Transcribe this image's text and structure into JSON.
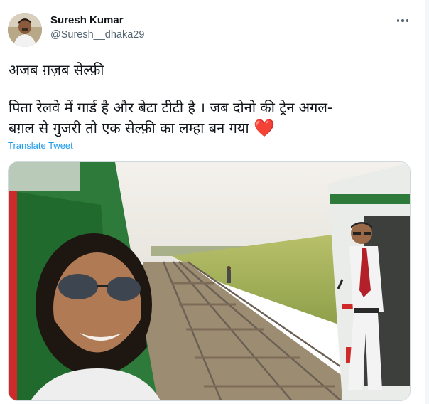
{
  "author": {
    "name": "Suresh Kumar",
    "handle": "@Suresh__dhaka29",
    "avatar_icon": "user-avatar"
  },
  "more_icon": "more-horizontal-icon",
  "tweet": {
    "title": "अजब ग़ज़ब सेल्फ़ी",
    "body_line1": "पिता रेलवे में गार्ड है और बेटा टीटी है । जब दोनो की ट्रेन अगल-",
    "body_line2": "बग़ल से गुजरी तो एक सेल्फ़ी का लम्हा बन गया",
    "heart": "❤️"
  },
  "translate_label": "Translate Tweet",
  "colors": {
    "link": "#1d9bf0",
    "secondary_text": "#536471",
    "primary_text": "#0f1419",
    "heart": "#e0245e"
  },
  "media": {
    "type": "photo",
    "subject": "selfie between two passing trains"
  }
}
